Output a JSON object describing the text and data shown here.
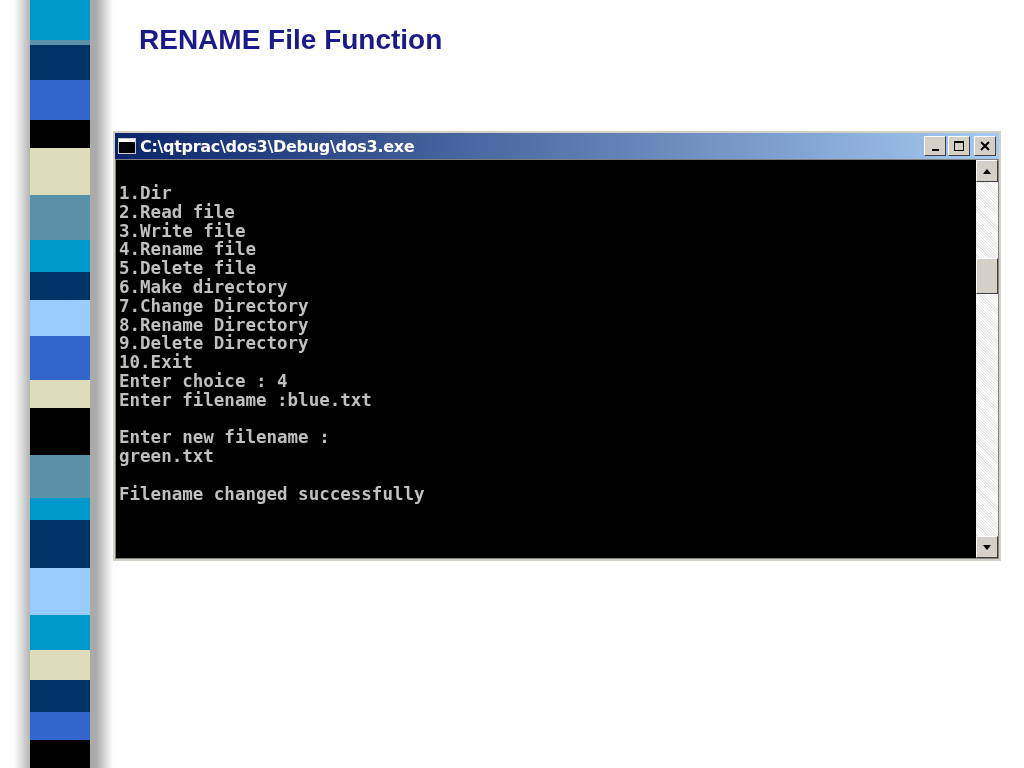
{
  "slide_title": "RENAME File Function",
  "window": {
    "title": "C:\\qtprac\\dos3\\Debug\\dos3.exe"
  },
  "console_blocks": [
    {
      "lines": [
        "1.Dir",
        "2.Read file",
        "3.Write file",
        "4.Rename file",
        "5.Delete file",
        "6.Make directory",
        "7.Change Directory",
        "8.Rename Directory",
        "9.Delete Directory",
        "10.Exit",
        "Enter choice : 4",
        "Enter filename :blue.txt"
      ]
    },
    {
      "lines": [
        "Enter new filename :",
        "green.txt"
      ]
    },
    {
      "lines": [
        "Filename changed successfully"
      ]
    }
  ]
}
